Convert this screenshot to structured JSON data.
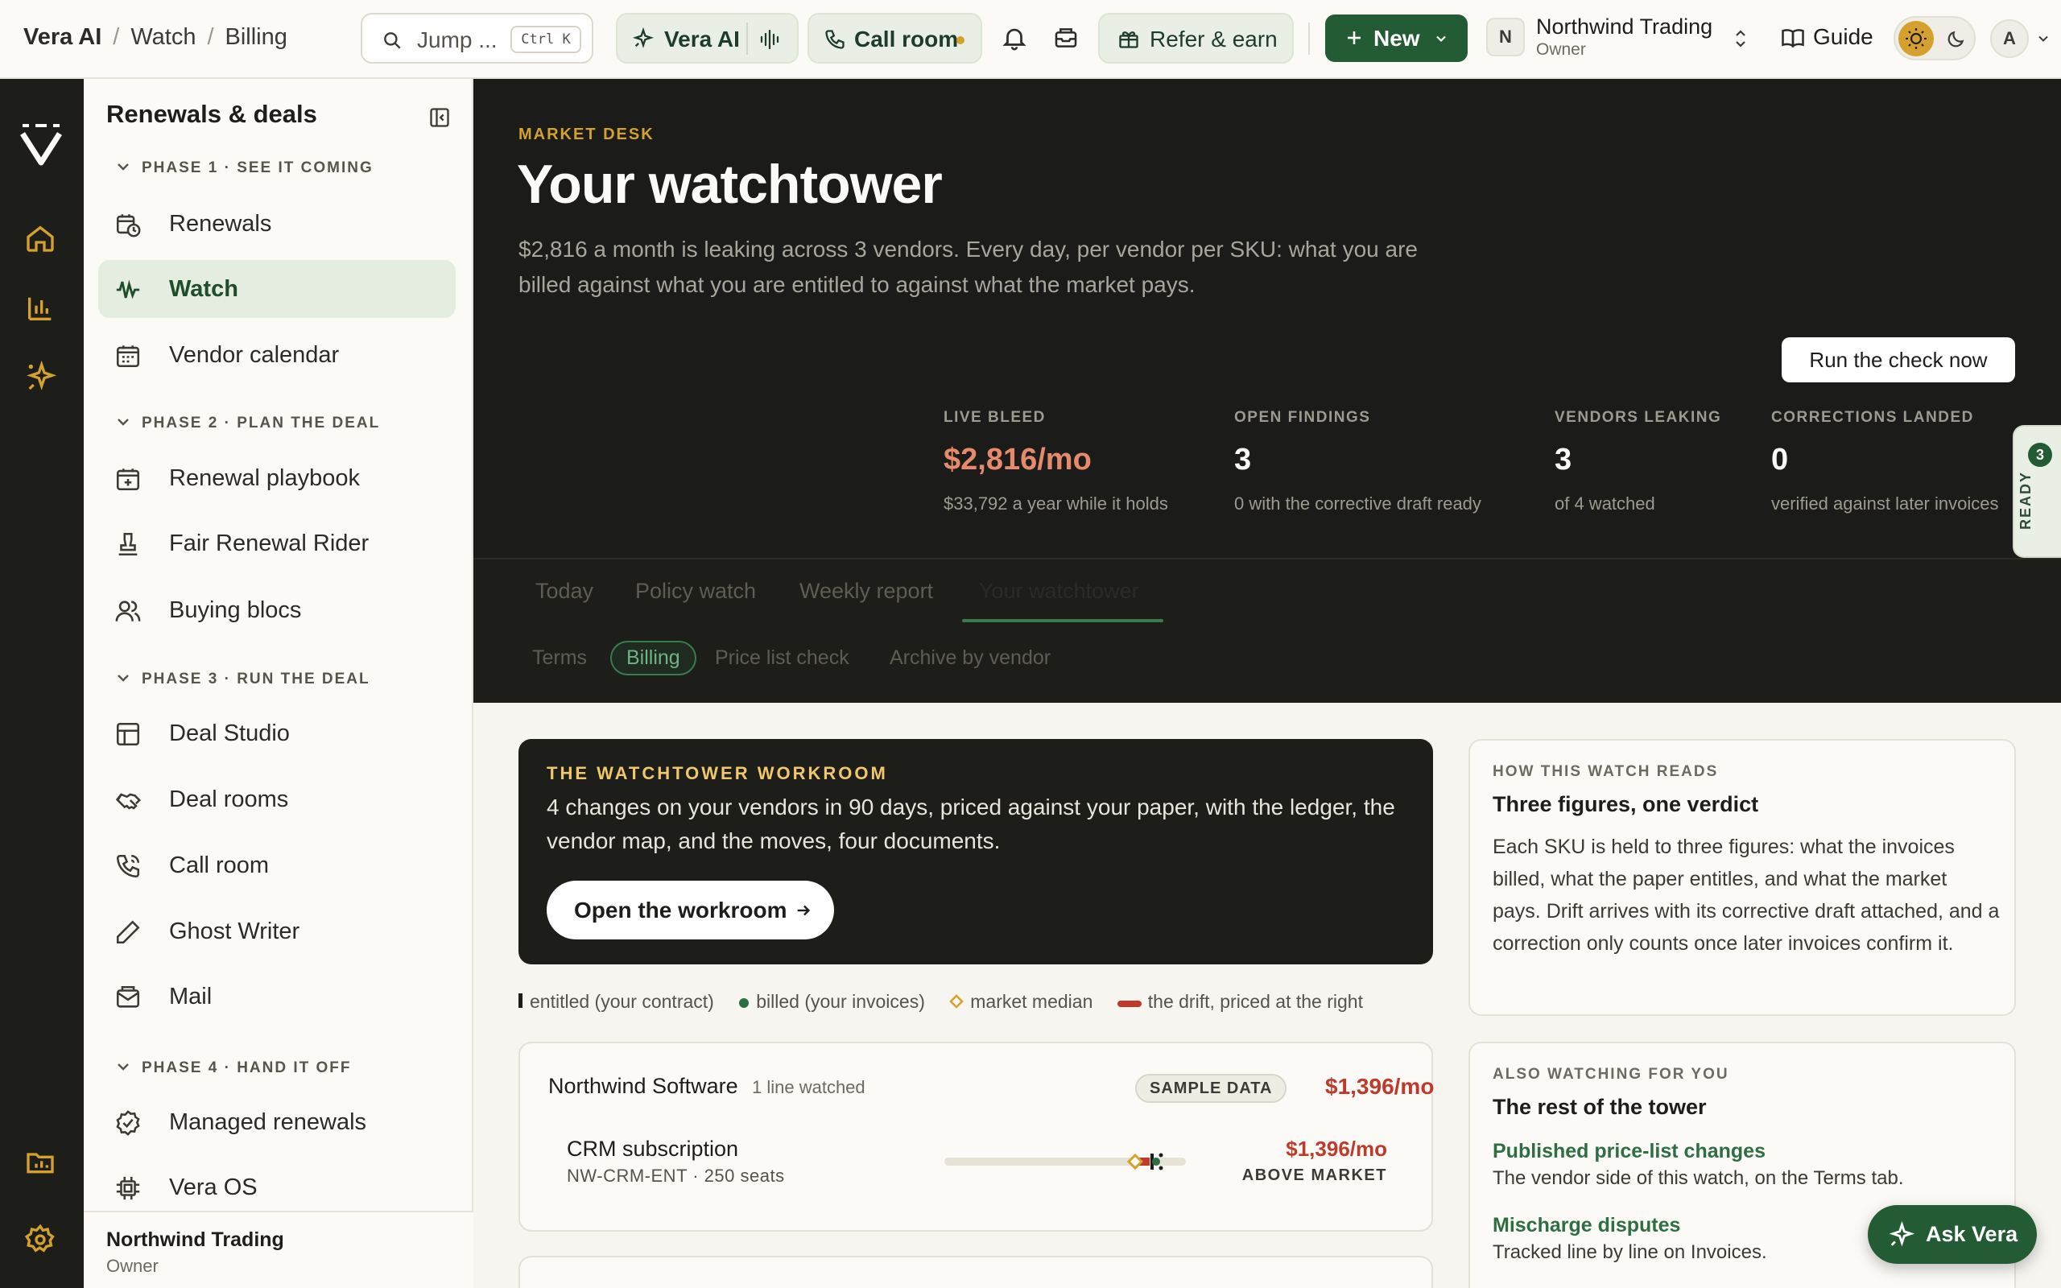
{
  "colors": {
    "accent": "#235c34",
    "hero_bg": "#1b1b19",
    "bleed": "#e58a6c",
    "danger": "#c03a2b",
    "gold": "#d4a12c"
  },
  "breadcrumb": [
    "Vera AI",
    "Watch",
    "Billing"
  ],
  "search": {
    "label": "Jump ...",
    "shortcut": "Ctrl K"
  },
  "topbar": {
    "vera_ai": "Vera AI",
    "call_room": "Call room",
    "refer": "Refer & earn",
    "new": "New",
    "org": {
      "initial": "N",
      "name": "Northwind Trading",
      "role": "Owner"
    },
    "guide": "Guide",
    "user_initial": "A"
  },
  "rail": {
    "icons": [
      "vera-logo-icon",
      "home-icon",
      "chart-icon",
      "sparkle-icon",
      "folder-chart-icon",
      "gear-icon"
    ]
  },
  "sidebar": {
    "title": "Renewals & deals",
    "phases": [
      {
        "label": "PHASE 1 · SEE IT COMING",
        "items": [
          {
            "label": "Renewals",
            "icon": "calendar-clock-icon"
          },
          {
            "label": "Watch",
            "icon": "waveform-icon",
            "active": true
          },
          {
            "label": "Vendor calendar",
            "icon": "calendar-icon"
          }
        ]
      },
      {
        "label": "PHASE 2 · PLAN THE DEAL",
        "items": [
          {
            "label": "Renewal playbook",
            "icon": "calendar-plus-icon"
          },
          {
            "label": "Fair Renewal Rider",
            "icon": "stamp-icon"
          },
          {
            "label": "Buying blocs",
            "icon": "users-icon"
          }
        ]
      },
      {
        "label": "PHASE 3 · RUN THE DEAL",
        "items": [
          {
            "label": "Deal Studio",
            "icon": "layout-icon"
          },
          {
            "label": "Deal rooms",
            "icon": "handshake-icon"
          },
          {
            "label": "Call room",
            "icon": "phone-icon"
          },
          {
            "label": "Ghost Writer",
            "icon": "pen-icon"
          },
          {
            "label": "Mail",
            "icon": "mail-icon"
          }
        ]
      },
      {
        "label": "PHASE 4 · HAND IT OFF",
        "items": [
          {
            "label": "Managed renewals",
            "icon": "check-badge-icon"
          },
          {
            "label": "Vera OS",
            "icon": "chip-icon"
          }
        ]
      }
    ],
    "footer": {
      "name": "Northwind Trading",
      "role": "Owner"
    }
  },
  "hero": {
    "kicker": "MARKET DESK",
    "title": "Your watchtower",
    "lede": "$2,816 a month is leaking across 3 vendors. Every day, per vendor per SKU: what you are billed against what you are entitled to against what the market pays.",
    "run_button": "Run the check now",
    "stats": [
      {
        "label": "LIVE BLEED",
        "value": "$2,816/mo",
        "sub": "$33,792 a year while it holds"
      },
      {
        "label": "OPEN FINDINGS",
        "value": "3",
        "sub": "0 with the corrective draft ready"
      },
      {
        "label": "VENDORS LEAKING",
        "value": "3",
        "sub": "of 4 watched"
      },
      {
        "label": "CORRECTIONS LANDED",
        "value": "0",
        "sub": "verified against later invoices"
      }
    ],
    "ready": {
      "count": "3",
      "label": "READY"
    }
  },
  "tabs": [
    "Today",
    "Policy watch",
    "Weekly report",
    "Your watchtower"
  ],
  "subtabs": [
    "Terms",
    "Billing",
    "Price list check",
    "Archive by vendor"
  ],
  "workroom": {
    "kicker": "THE WATCHTOWER WORKROOM",
    "text": "4 changes on your vendors in 90 days, priced against your paper, with the ledger, the vendor map, and the moves, four documents.",
    "button": "Open the workroom"
  },
  "legend": [
    {
      "label": "entitled (your contract)"
    },
    {
      "label": "billed (your invoices)"
    },
    {
      "label": "market median"
    },
    {
      "label": "the drift, priced at the right"
    }
  ],
  "vendors": [
    {
      "name": "Northwind Software",
      "watched": "1 line watched",
      "badge": "SAMPLE DATA",
      "total": "$1,396/mo",
      "lines": [
        {
          "sku": "CRM subscription",
          "meta": "NW-CRM-ENT · 250 seats",
          "amount": "$1,396/mo",
          "tag": "ABOVE MARKET"
        }
      ]
    }
  ],
  "how_card": {
    "kicker": "HOW THIS WATCH READS",
    "title": "Three figures, one verdict",
    "body": "Each SKU is held to three figures: what the invoices billed, what the paper entitles, and what the market pays. Drift arrives with its corrective draft attached, and a correction only counts once later invoices confirm it."
  },
  "also_card": {
    "kicker": "ALSO WATCHING FOR YOU",
    "title": "The rest of the tower",
    "links": [
      {
        "label": "Published price-list changes",
        "desc": "The vendor side of this watch, on the Terms tab."
      },
      {
        "label": "Mischarge disputes",
        "desc": "Tracked line by line on Invoices."
      }
    ]
  },
  "ask_vera": "Ask Vera"
}
